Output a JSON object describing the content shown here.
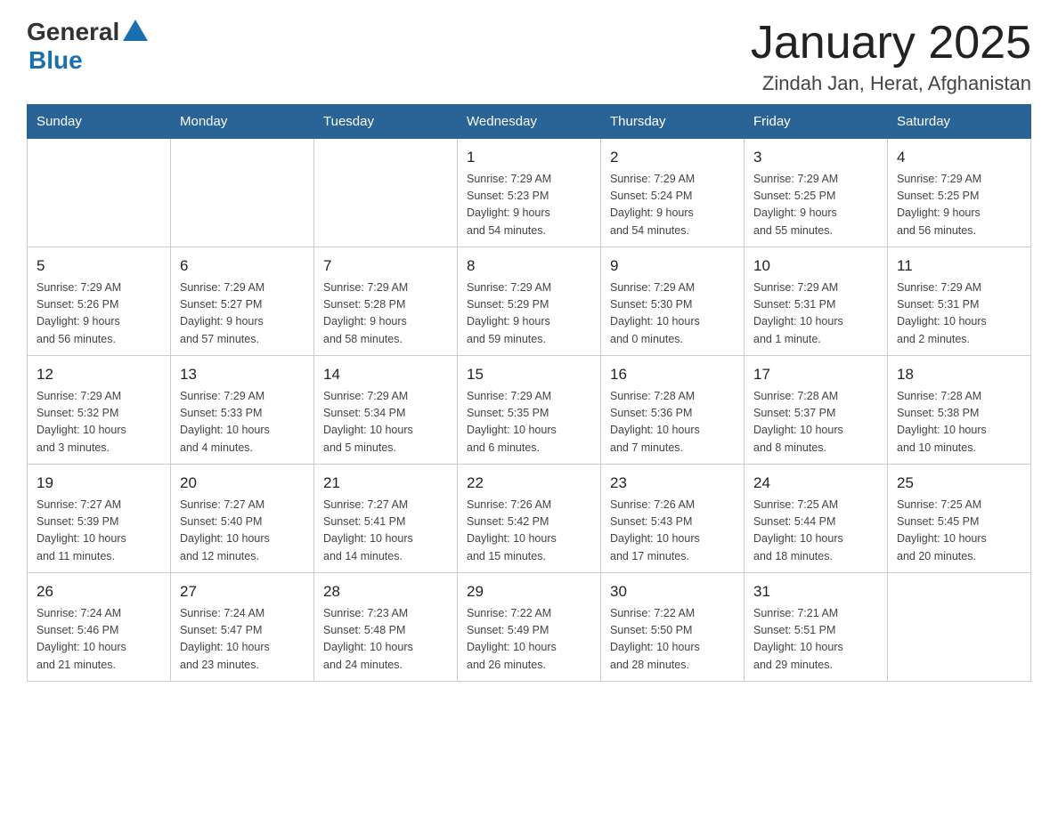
{
  "logo": {
    "general": "General",
    "blue": "Blue"
  },
  "title": {
    "month": "January 2025",
    "location": "Zindah Jan, Herat, Afghanistan"
  },
  "headers": [
    "Sunday",
    "Monday",
    "Tuesday",
    "Wednesday",
    "Thursday",
    "Friday",
    "Saturday"
  ],
  "weeks": [
    [
      {
        "day": "",
        "info": ""
      },
      {
        "day": "",
        "info": ""
      },
      {
        "day": "",
        "info": ""
      },
      {
        "day": "1",
        "info": "Sunrise: 7:29 AM\nSunset: 5:23 PM\nDaylight: 9 hours\nand 54 minutes."
      },
      {
        "day": "2",
        "info": "Sunrise: 7:29 AM\nSunset: 5:24 PM\nDaylight: 9 hours\nand 54 minutes."
      },
      {
        "day": "3",
        "info": "Sunrise: 7:29 AM\nSunset: 5:25 PM\nDaylight: 9 hours\nand 55 minutes."
      },
      {
        "day": "4",
        "info": "Sunrise: 7:29 AM\nSunset: 5:25 PM\nDaylight: 9 hours\nand 56 minutes."
      }
    ],
    [
      {
        "day": "5",
        "info": "Sunrise: 7:29 AM\nSunset: 5:26 PM\nDaylight: 9 hours\nand 56 minutes."
      },
      {
        "day": "6",
        "info": "Sunrise: 7:29 AM\nSunset: 5:27 PM\nDaylight: 9 hours\nand 57 minutes."
      },
      {
        "day": "7",
        "info": "Sunrise: 7:29 AM\nSunset: 5:28 PM\nDaylight: 9 hours\nand 58 minutes."
      },
      {
        "day": "8",
        "info": "Sunrise: 7:29 AM\nSunset: 5:29 PM\nDaylight: 9 hours\nand 59 minutes."
      },
      {
        "day": "9",
        "info": "Sunrise: 7:29 AM\nSunset: 5:30 PM\nDaylight: 10 hours\nand 0 minutes."
      },
      {
        "day": "10",
        "info": "Sunrise: 7:29 AM\nSunset: 5:31 PM\nDaylight: 10 hours\nand 1 minute."
      },
      {
        "day": "11",
        "info": "Sunrise: 7:29 AM\nSunset: 5:31 PM\nDaylight: 10 hours\nand 2 minutes."
      }
    ],
    [
      {
        "day": "12",
        "info": "Sunrise: 7:29 AM\nSunset: 5:32 PM\nDaylight: 10 hours\nand 3 minutes."
      },
      {
        "day": "13",
        "info": "Sunrise: 7:29 AM\nSunset: 5:33 PM\nDaylight: 10 hours\nand 4 minutes."
      },
      {
        "day": "14",
        "info": "Sunrise: 7:29 AM\nSunset: 5:34 PM\nDaylight: 10 hours\nand 5 minutes."
      },
      {
        "day": "15",
        "info": "Sunrise: 7:29 AM\nSunset: 5:35 PM\nDaylight: 10 hours\nand 6 minutes."
      },
      {
        "day": "16",
        "info": "Sunrise: 7:28 AM\nSunset: 5:36 PM\nDaylight: 10 hours\nand 7 minutes."
      },
      {
        "day": "17",
        "info": "Sunrise: 7:28 AM\nSunset: 5:37 PM\nDaylight: 10 hours\nand 8 minutes."
      },
      {
        "day": "18",
        "info": "Sunrise: 7:28 AM\nSunset: 5:38 PM\nDaylight: 10 hours\nand 10 minutes."
      }
    ],
    [
      {
        "day": "19",
        "info": "Sunrise: 7:27 AM\nSunset: 5:39 PM\nDaylight: 10 hours\nand 11 minutes."
      },
      {
        "day": "20",
        "info": "Sunrise: 7:27 AM\nSunset: 5:40 PM\nDaylight: 10 hours\nand 12 minutes."
      },
      {
        "day": "21",
        "info": "Sunrise: 7:27 AM\nSunset: 5:41 PM\nDaylight: 10 hours\nand 14 minutes."
      },
      {
        "day": "22",
        "info": "Sunrise: 7:26 AM\nSunset: 5:42 PM\nDaylight: 10 hours\nand 15 minutes."
      },
      {
        "day": "23",
        "info": "Sunrise: 7:26 AM\nSunset: 5:43 PM\nDaylight: 10 hours\nand 17 minutes."
      },
      {
        "day": "24",
        "info": "Sunrise: 7:25 AM\nSunset: 5:44 PM\nDaylight: 10 hours\nand 18 minutes."
      },
      {
        "day": "25",
        "info": "Sunrise: 7:25 AM\nSunset: 5:45 PM\nDaylight: 10 hours\nand 20 minutes."
      }
    ],
    [
      {
        "day": "26",
        "info": "Sunrise: 7:24 AM\nSunset: 5:46 PM\nDaylight: 10 hours\nand 21 minutes."
      },
      {
        "day": "27",
        "info": "Sunrise: 7:24 AM\nSunset: 5:47 PM\nDaylight: 10 hours\nand 23 minutes."
      },
      {
        "day": "28",
        "info": "Sunrise: 7:23 AM\nSunset: 5:48 PM\nDaylight: 10 hours\nand 24 minutes."
      },
      {
        "day": "29",
        "info": "Sunrise: 7:22 AM\nSunset: 5:49 PM\nDaylight: 10 hours\nand 26 minutes."
      },
      {
        "day": "30",
        "info": "Sunrise: 7:22 AM\nSunset: 5:50 PM\nDaylight: 10 hours\nand 28 minutes."
      },
      {
        "day": "31",
        "info": "Sunrise: 7:21 AM\nSunset: 5:51 PM\nDaylight: 10 hours\nand 29 minutes."
      },
      {
        "day": "",
        "info": ""
      }
    ]
  ]
}
